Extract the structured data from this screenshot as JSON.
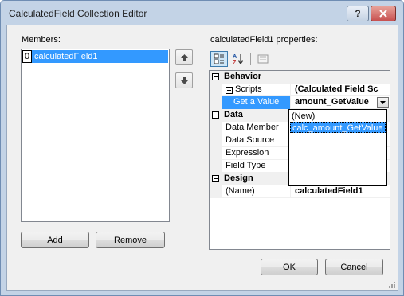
{
  "window": {
    "title": "CalculatedField Collection Editor",
    "help_label": "?"
  },
  "members": {
    "label": "Members:",
    "items": [
      {
        "index": "0",
        "name": "calculatedField1"
      }
    ]
  },
  "buttons": {
    "add": "Add",
    "remove": "Remove",
    "ok": "OK",
    "cancel": "Cancel"
  },
  "properties": {
    "label": "calculatedField1 properties:",
    "categories": [
      {
        "name": "Behavior",
        "rows": [
          {
            "name": "Scripts",
            "value": "(Calculated Field Sc"
          },
          {
            "name": "Get a Value",
            "value": "amount_GetValue"
          }
        ]
      },
      {
        "name": "Data",
        "rows": [
          {
            "name": "Data Member",
            "value": ""
          },
          {
            "name": "Data Source",
            "value": ""
          },
          {
            "name": "Expression",
            "value": ""
          },
          {
            "name": "Field Type",
            "value": ""
          }
        ]
      },
      {
        "name": "Design",
        "rows": [
          {
            "name": "(Name)",
            "value": "calculatedField1"
          }
        ]
      }
    ],
    "dropdown_options": [
      "(New)",
      "calc_amount_GetValue"
    ],
    "dropdown_selected": "calc_amount_GetValue"
  },
  "icons": {
    "close": "close-icon",
    "move_up": "arrow-up-icon",
    "move_down": "arrow-down-icon",
    "categorized": "categorized-icon",
    "alphabetical": "alphabetical-sort-icon",
    "property_pages": "property-pages-icon"
  },
  "colors": {
    "selection": "#3399ff",
    "close_button": "#c75050",
    "frame": "#c3d3e6"
  }
}
